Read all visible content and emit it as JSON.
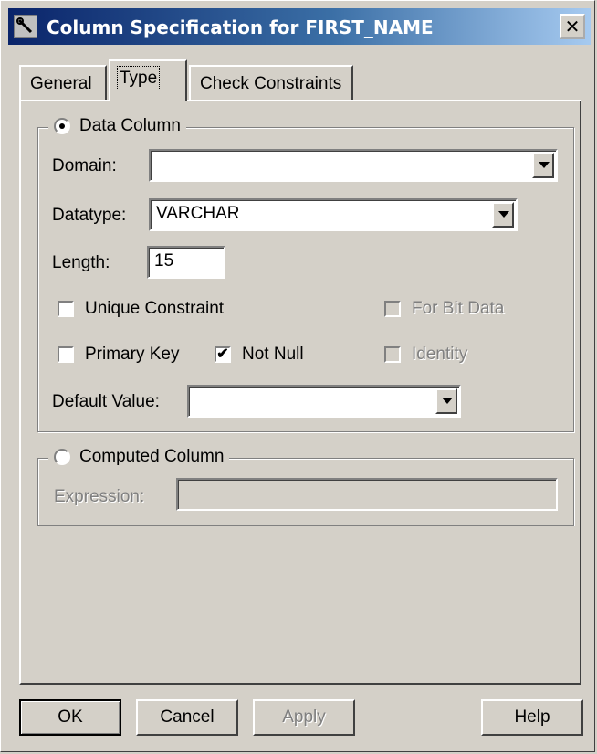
{
  "window": {
    "title": "Column Specification for FIRST_NAME",
    "close_label": "✕"
  },
  "tabs": [
    {
      "label": "General",
      "active": false
    },
    {
      "label": "Type",
      "active": true
    },
    {
      "label": "Check Constraints",
      "active": false
    }
  ],
  "data_column": {
    "legend": "Data Column",
    "selected": true,
    "domain": {
      "label": "Domain:",
      "value": ""
    },
    "datatype": {
      "label": "Datatype:",
      "value": "VARCHAR"
    },
    "length": {
      "label": "Length:",
      "value": "15"
    },
    "unique_constraint": {
      "label": "Unique Constraint",
      "checked": false
    },
    "for_bit_data": {
      "label": "For Bit Data",
      "checked": false,
      "enabled": false
    },
    "primary_key": {
      "label": "Primary Key",
      "checked": false
    },
    "not_null": {
      "label": "Not Null",
      "checked": true
    },
    "identity": {
      "label": "Identity",
      "checked": false,
      "enabled": false
    },
    "default_value": {
      "label": "Default Value:",
      "value": ""
    }
  },
  "computed_column": {
    "legend": "Computed Column",
    "selected": false,
    "expression": {
      "label": "Expression:",
      "value": ""
    }
  },
  "buttons": {
    "ok": "OK",
    "cancel": "Cancel",
    "apply": "Apply",
    "help": "Help"
  },
  "colors": {
    "titlebar_start": "#0a246a",
    "titlebar_end": "#a6caf0",
    "face": "#d4d0c8"
  },
  "icons": {
    "title": "wrench-icon",
    "close": "close-icon"
  }
}
